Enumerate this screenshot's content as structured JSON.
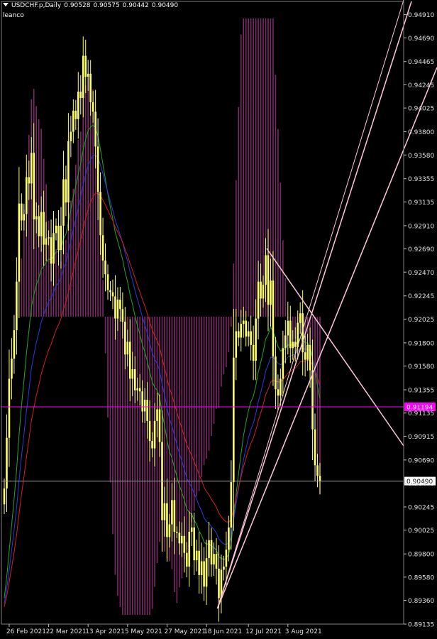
{
  "header": {
    "symbol": "USDCHF.p,Daily",
    "open": "0.90528",
    "high": "0.90575",
    "low": "0.90442",
    "close": "0.90490",
    "indicator": "leanco"
  },
  "colors": {
    "background": "#000000",
    "candle": "#ffff66",
    "histogram": "#7a2a66",
    "ma_green": "#1fa81f",
    "ma_blue": "#2b3bd9",
    "ma_red": "#d02020",
    "trend_lines": "#ffc8d8",
    "horizontal_magenta": "#ff00ff",
    "horizontal_gray": "#a0a0a0"
  },
  "chart_data": {
    "type": "candlestick",
    "ylim": [
      0.89135,
      0.95035
    ],
    "y_ticks": [
      "0.94910",
      "0.94690",
      "0.94465",
      "0.94245",
      "0.94025",
      "0.93800",
      "0.93580",
      "0.93355",
      "0.93135",
      "0.92910",
      "0.92690",
      "0.92470",
      "0.92245",
      "0.92025",
      "0.91800",
      "0.91580",
      "0.91355",
      "0.91135",
      "0.90915",
      "0.90690",
      "0.90470",
      "0.90245",
      "0.90025",
      "0.89800",
      "0.89580",
      "0.89360",
      "0.89135"
    ],
    "x_labels": [
      "26 Feb 2021",
      "22 Mar 2021",
      "13 Apr 2021",
      "5 May 2021",
      "27 May 2021",
      "18 Jun 2021",
      "12 Jul 2021",
      "3 Aug 2021"
    ],
    "price_close": [
      0.9042,
      0.909,
      0.9146,
      0.9165,
      0.9192,
      0.9238,
      0.9312,
      0.9296,
      0.9302,
      0.9337,
      0.9331,
      0.936,
      0.9297,
      0.93,
      0.9281,
      0.9304,
      0.9273,
      0.9279,
      0.928,
      0.9255,
      0.9284,
      0.9291,
      0.9268,
      0.9291,
      0.9335,
      0.9313,
      0.9371,
      0.938,
      0.94,
      0.9392,
      0.9418,
      0.9412,
      0.9452,
      0.9432,
      0.9435,
      0.9408,
      0.9399,
      0.9366,
      0.9323,
      0.9282,
      0.9258,
      0.9245,
      0.923,
      0.9228,
      0.9224,
      0.9203,
      0.9221,
      0.9212,
      0.92,
      0.9169,
      0.9181,
      0.9146,
      0.9155,
      0.9135,
      0.9137,
      0.9134,
      0.9115,
      0.9126,
      0.9106,
      0.9087,
      0.908,
      0.9106,
      0.9117,
      0.9086,
      0.9012,
      0.9028,
      0.8996,
      0.9008,
      0.9031,
      0.9001,
      0.9,
      0.899,
      0.8997,
      0.8981,
      0.8968,
      0.9001,
      0.9005,
      0.8974,
      0.8983,
      0.896,
      0.8973,
      0.8949,
      0.8976,
      0.8993,
      0.897,
      0.898,
      0.8966,
      0.8938,
      0.8965,
      0.8968,
      0.8984,
      0.9005,
      0.9048,
      0.9166,
      0.9191,
      0.9185,
      0.9198,
      0.9201,
      0.9186,
      0.9191,
      0.9178,
      0.9163,
      0.9203,
      0.9238,
      0.9222,
      0.9235,
      0.9263,
      0.9216,
      0.9239,
      0.9167,
      0.9136,
      0.913,
      0.9146,
      0.9175,
      0.9187,
      0.9201,
      0.9175,
      0.9181,
      0.9176,
      0.9199,
      0.9208,
      0.9171,
      0.9164,
      0.9178,
      0.9154,
      0.9098,
      0.9064,
      0.9054,
      0.9049
    ],
    "ma_green_end": 0.9166,
    "ma_blue_end": 0.9135,
    "ma_red_end": 0.9113,
    "horizontal_levels": [
      {
        "value": 0.91194,
        "label": "0.91194",
        "color": "#ff00ff"
      },
      {
        "value": 0.9049,
        "label": "0.90490",
        "color": "#a0a0a0"
      }
    ]
  }
}
